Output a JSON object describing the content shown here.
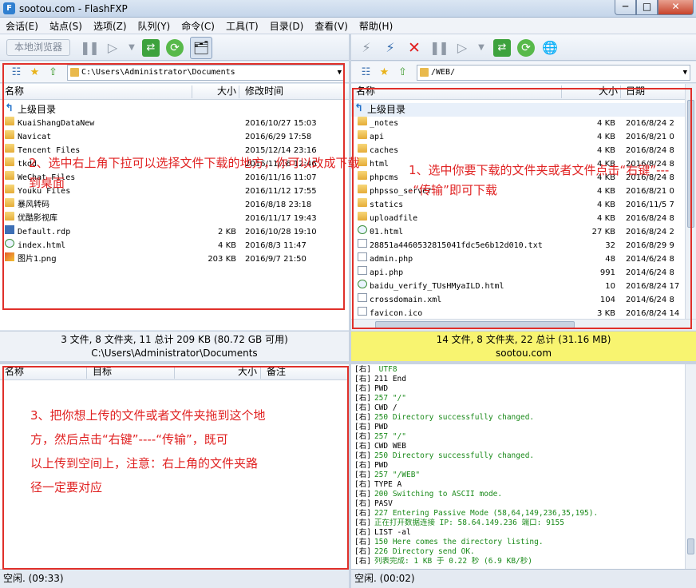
{
  "window": {
    "title": "sootou.com - FlashFXP",
    "controls": {
      "minimize": "─",
      "maximize": "□",
      "close": "✕"
    }
  },
  "menu": [
    "会话(E)",
    "站点(S)",
    "选项(Z)",
    "队列(Y)",
    "命令(C)",
    "工具(T)",
    "目录(D)",
    "查看(V)",
    "帮助(H)"
  ],
  "toolbar_left": {
    "local_browser": "本地浏览器"
  },
  "icons": [
    "connect-icon",
    "disconnect-icon",
    "abort-icon",
    "pause-icon",
    "play-icon",
    "transfer-icon",
    "refresh-icon",
    "compare-icon",
    "site-icon",
    "tree-icon",
    "favorites-icon",
    "up-folder-icon",
    "folder-icon"
  ],
  "left": {
    "path": "C:\\Users\\Administrator\\Documents",
    "columns": {
      "name": "名称",
      "size": "大小",
      "modified": "修改时间"
    },
    "parent": "上级目录",
    "files": [
      {
        "name": "KuaiShangDataNew",
        "size": "",
        "date": "2016/10/27 15:03",
        "type": "folder"
      },
      {
        "name": "Navicat",
        "size": "",
        "date": "2016/6/29 17:58",
        "type": "folder"
      },
      {
        "name": "Tencent Files",
        "size": "",
        "date": "2015/12/14 23:16",
        "type": "folder"
      },
      {
        "name": "tkdd",
        "size": "",
        "date": "2016/11/16 12:46",
        "type": "folder"
      },
      {
        "name": "WeChat Files",
        "size": "",
        "date": "2016/11/16 11:07",
        "type": "folder"
      },
      {
        "name": "Youku Files",
        "size": "",
        "date": "2016/11/12 17:55",
        "type": "folder"
      },
      {
        "name": "暴风转码",
        "size": "",
        "date": "2016/8/18 23:18",
        "type": "folder"
      },
      {
        "name": "优酷影视库",
        "size": "",
        "date": "2016/11/17 19:43",
        "type": "folder"
      },
      {
        "name": "Default.rdp",
        "size": "2 KB",
        "date": "2016/10/28 19:10",
        "type": "rdp"
      },
      {
        "name": "index.html",
        "size": "4 KB",
        "date": "2016/8/3 11:47",
        "type": "html"
      },
      {
        "name": "图片1.png",
        "size": "203 KB",
        "date": "2016/9/7 21:50",
        "type": "png"
      }
    ],
    "status_line1": "3 文件, 8 文件夹, 11 总计 209 KB (80.72 GB 可用)",
    "status_line2": "C:\\Users\\Administrator\\Documents"
  },
  "right": {
    "path": "/WEB/",
    "columns": {
      "name": "名称",
      "size": "大小",
      "date": "日期"
    },
    "parent": "上级目录",
    "files": [
      {
        "name": "_notes",
        "size": "4 KB",
        "date": "2016/8/24 2",
        "type": "folder"
      },
      {
        "name": "api",
        "size": "4 KB",
        "date": "2016/8/21 0",
        "type": "folder"
      },
      {
        "name": "caches",
        "size": "4 KB",
        "date": "2016/8/24 8",
        "type": "folder"
      },
      {
        "name": "html",
        "size": "4 KB",
        "date": "2016/8/24 8",
        "type": "folder"
      },
      {
        "name": "phpcms",
        "size": "4 KB",
        "date": "2016/8/24 8",
        "type": "folder"
      },
      {
        "name": "phpsso_server",
        "size": "4 KB",
        "date": "2016/8/21 0",
        "type": "folder"
      },
      {
        "name": "statics",
        "size": "4 KB",
        "date": "2016/11/5 7",
        "type": "folder"
      },
      {
        "name": "uploadfile",
        "size": "4 KB",
        "date": "2016/8/24 8",
        "type": "folder"
      },
      {
        "name": "01.html",
        "size": "27 KB",
        "date": "2016/8/24 2",
        "type": "html"
      },
      {
        "name": "28851a4460532815041fdc5e6b12d010.txt",
        "size": "32",
        "date": "2016/8/29 9",
        "type": "file"
      },
      {
        "name": "admin.php",
        "size": "48",
        "date": "2014/6/24 8",
        "type": "file"
      },
      {
        "name": "api.php",
        "size": "991",
        "date": "2014/6/24 8",
        "type": "file"
      },
      {
        "name": "baidu_verify_TUsHMyaILD.html",
        "size": "10",
        "date": "2016/8/24 17",
        "type": "html"
      },
      {
        "name": "crossdomain.xml",
        "size": "104",
        "date": "2014/6/24 8",
        "type": "file"
      },
      {
        "name": "favicon.ico",
        "size": "3 KB",
        "date": "2016/8/24 14",
        "type": "file"
      }
    ],
    "status_line1": "14 文件, 8 文件夹, 22 总计 (31.16 MB)",
    "status_line2": "sootou.com"
  },
  "queue": {
    "columns": {
      "name": "名称",
      "target": "目标",
      "size": "大小",
      "note": "备注"
    }
  },
  "log": [
    {
      "tag": "[右]",
      "text": " UTF8",
      "color": "#1a8a1a"
    },
    {
      "tag": "[右]",
      "text": "211 End",
      "color": "#000000"
    },
    {
      "tag": "[右]",
      "text": "PWD",
      "color": "#000000"
    },
    {
      "tag": "[右]",
      "text": "257 \"/\"",
      "color": "#1a8a1a"
    },
    {
      "tag": "[右]",
      "text": "CWD /",
      "color": "#000000"
    },
    {
      "tag": "[右]",
      "text": "250 Directory successfully changed.",
      "color": "#1a8a1a"
    },
    {
      "tag": "[右]",
      "text": "PWD",
      "color": "#000000"
    },
    {
      "tag": "[右]",
      "text": "257 \"/\"",
      "color": "#1a8a1a"
    },
    {
      "tag": "[右]",
      "text": "CWD WEB",
      "color": "#000000"
    },
    {
      "tag": "[右]",
      "text": "250 Directory successfully changed.",
      "color": "#1a8a1a"
    },
    {
      "tag": "[右]",
      "text": "PWD",
      "color": "#000000"
    },
    {
      "tag": "[右]",
      "text": "257 \"/WEB\"",
      "color": "#1a8a1a"
    },
    {
      "tag": "[右]",
      "text": "TYPE A",
      "color": "#000000"
    },
    {
      "tag": "[右]",
      "text": "200 Switching to ASCII mode.",
      "color": "#1a8a1a"
    },
    {
      "tag": "[右]",
      "text": "PASV",
      "color": "#000000"
    },
    {
      "tag": "[右]",
      "text": "227 Entering Passive Mode (58,64,149,236,35,195).",
      "color": "#1a8a1a"
    },
    {
      "tag": "[右]",
      "text": "正在打开数据连接 IP: 58.64.149.236 端口: 9155",
      "color": "#1a8a1a"
    },
    {
      "tag": "[右]",
      "text": "LIST -al",
      "color": "#000000"
    },
    {
      "tag": "[右]",
      "text": "150 Here comes the directory listing.",
      "color": "#1a8a1a"
    },
    {
      "tag": "[右]",
      "text": "226 Directory send OK.",
      "color": "#1a8a1a"
    },
    {
      "tag": "[右]",
      "text": "列表完成: 1 KB 于 0.22 秒 (6.9 KB/秒)",
      "color": "#1a8a1a"
    }
  ],
  "bottom": {
    "left_status": "空闲. (09:33)",
    "right_status": "空闲. (00:02)"
  },
  "annotations": {
    "left_top": "2、选中右上角下拉可以选择文件下载的地方，你可以改成下载到桌面",
    "right_top": "1、选中你要下载的文件夹或者文件点击“右键”----“传输”即可下载",
    "queue_line1": "3、把你想上传的文件或者文件夹拖到这个地",
    "queue_line2": "方，然后点击“右键”----“传输”，既可",
    "queue_line3": "以上传到空间上，注意：右上角的文件夹路",
    "queue_line4": "径一定要对应"
  },
  "colors": {
    "annotation_red": "#e0302a",
    "status_yellow": "#f8f470",
    "log_green": "#1a8a1a"
  }
}
